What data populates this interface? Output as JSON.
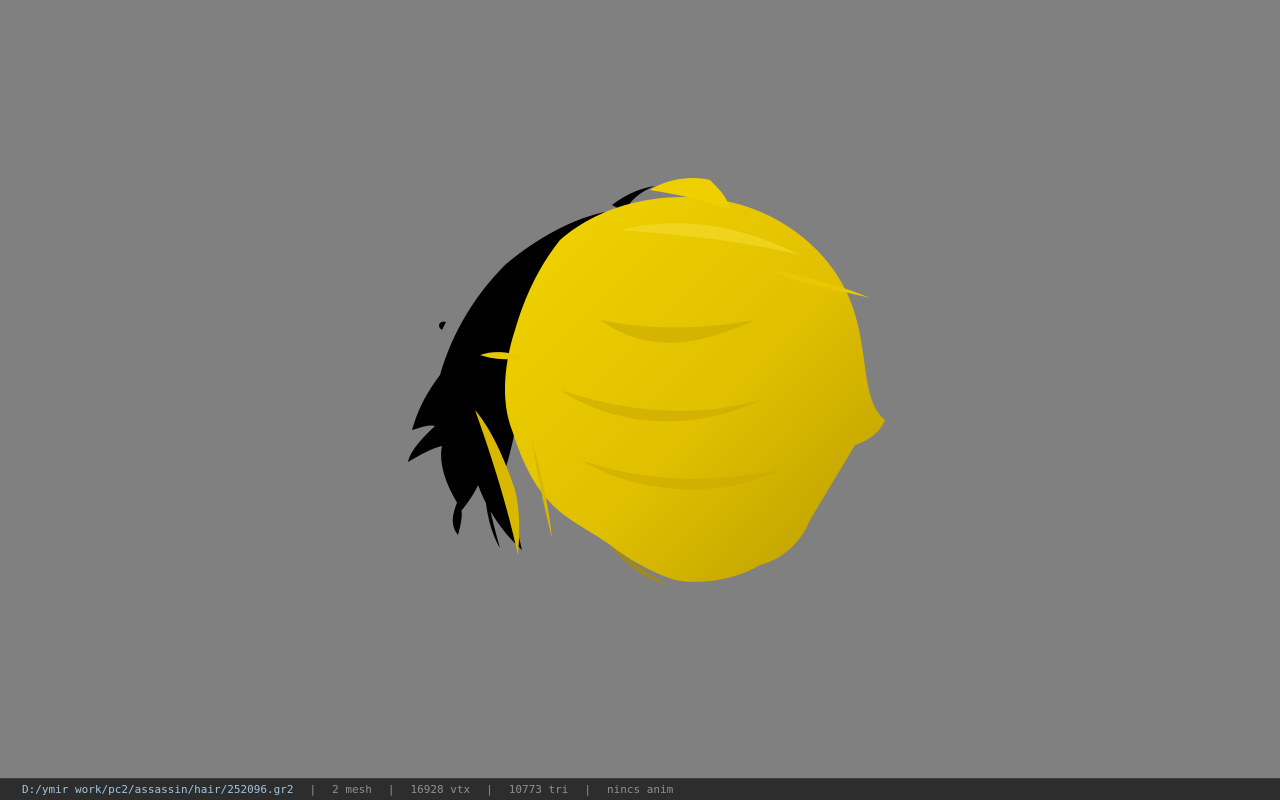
{
  "viewer": {
    "background_color": "#808080",
    "model": {
      "description_icon": "hair-mesh",
      "primary_color": "#e8c800",
      "shadow_color": "#000000"
    }
  },
  "statusbar": {
    "file_path": "D:/ymir work/pc2/assassin/hair/252096.gr2",
    "mesh_count": "2 mesh",
    "vertex_count": "16928 vtx",
    "triangle_count": "10773 tri",
    "anim_status": "nincs anim",
    "separator": "|"
  }
}
